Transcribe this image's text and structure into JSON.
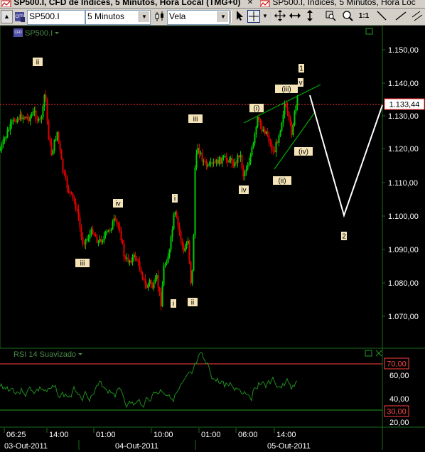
{
  "tabs": [
    {
      "label": "SP500.I, CFD de Índices, 5 Minutos, Hora Local (TMG+0)",
      "active": true
    },
    {
      "label": "SP500.I, Índices, 5 Minutos, Hora Loc",
      "active": false
    }
  ],
  "toolbar": {
    "symbol_value": "SP500.I",
    "interval_value": "5 Minutos",
    "chart_type_value": "Vela",
    "interval_arrow": "▼",
    "chart_type_arrow": "▼",
    "cursor_arrow": "▼",
    "one_to_one_label": "1:1"
  },
  "chart": {
    "symbol_label": "SP500.I",
    "current_price_label": "1.133,44",
    "price_axis_labels": [
      "1.150,00",
      "1.140,00",
      "1.130,00",
      "1.120,00",
      "1.110,00",
      "1.100,00",
      "1.090,00",
      "1.080,00",
      "1.070,00"
    ],
    "wave_labels": [
      "ii",
      "i",
      "iii",
      "iv",
      "i",
      "ii",
      "iii",
      "iv",
      "(i)",
      "(ii)",
      "(iii)",
      "(iv)",
      "v",
      "1",
      "2"
    ],
    "colors": {
      "up": "#00cc00",
      "down": "#e00000",
      "price_line": "#ff3333",
      "trendline": "#00aa00",
      "projection": "#ffffff",
      "label_bg": "#f5e4b8"
    }
  },
  "rsi": {
    "title": "RSI 14 Suavizado",
    "upper_level_label": "70,00",
    "lower_level_label": "30,00",
    "axis_labels": [
      "60,00",
      "40,00",
      "20,00"
    ],
    "colors": {
      "line": "#1e8c1e",
      "level": "#ff4040"
    }
  },
  "time_axis": {
    "time_labels": [
      "06:25",
      "14:00",
      "01:00",
      "10:00",
      "01:00",
      "06:00",
      "14:00"
    ],
    "date_labels": [
      "03-Out-2011",
      "04-Out-2011",
      "05-Out-2011"
    ]
  }
}
